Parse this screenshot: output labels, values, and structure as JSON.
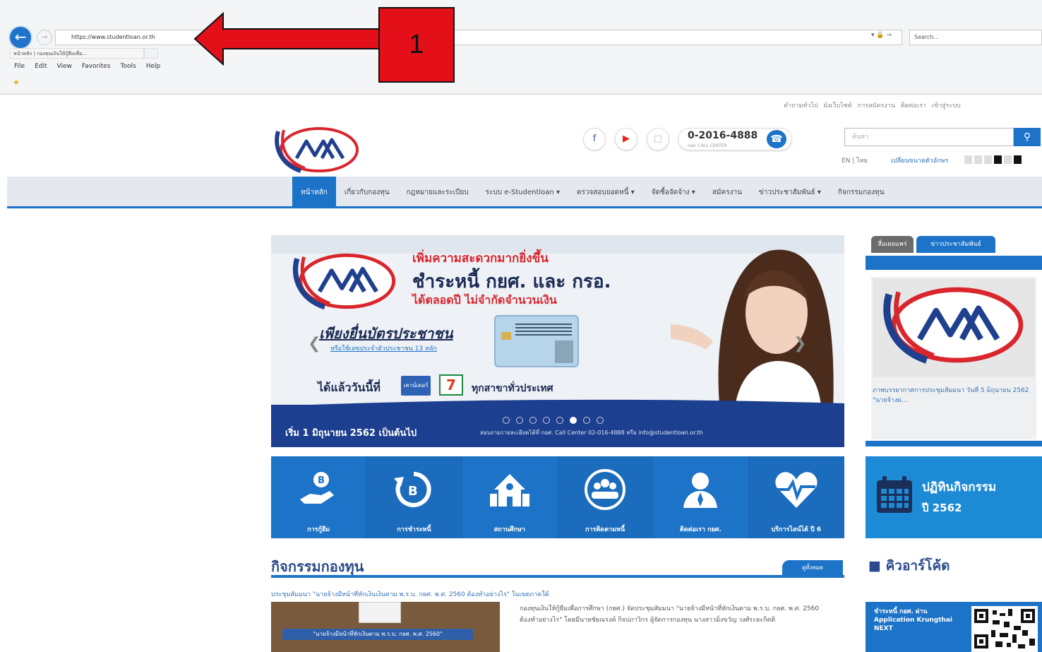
{
  "browser": {
    "url": "https://www.studentloan.or.th",
    "search_placeholder": "Search...",
    "tab_title": "หน้าหลัก | กองทุนเงินให้กู้ยืมเพื่อ...",
    "menu": [
      "File",
      "Edit",
      "View",
      "Favorites",
      "Tools",
      "Help"
    ]
  },
  "annotation": {
    "callout_number": "1",
    "arrow_color": "#e3101a"
  },
  "site": {
    "utility_links": [
      "คำถามทั่วไป",
      "ผังเว็บไซต์",
      "การสมัครงาน",
      "ติดต่อเรา",
      "เข้าสู่ระบบ"
    ],
    "phone": {
      "number": "0-2016-4888",
      "sub": "กยศ. CALL CENTER"
    },
    "search_placeholder": "ค้นหา",
    "language": "EN | ไทย",
    "font_size_label": "เปลี่ยนขนาดตัวอักษร",
    "nav": [
      "หน้าหลัก",
      "เกี่ยวกับกองทุน",
      "กฎหมายและระเบียบ",
      "ระบบ e-Studentloan ▾",
      "ตรวจสอบยอดหนี้ ▾",
      "จัดซื้อจัดจ้าง ▾",
      "สมัครงาน",
      "ข่าวประชาสัมพันธ์ ▾",
      "กิจกรรมกองทุน"
    ],
    "accent_color": "#1c73c7"
  },
  "banner": {
    "heading1": "เพิ่มความสะดวกมากยิ่งขึ้น",
    "heading2": "ชำระหนี้ กยศ. และ กรอ.",
    "heading3": "ได้ตลอดปี ไม่จำกัดจำนวนเงิน",
    "id_text": "เพียงยื่นบัตรประชาชน",
    "id_sub": "หรือใช้เลขประจำตัวประชาชน 13 หลัก",
    "today_text": "ได้แล้ววันนี้ที่",
    "store1": "เคาน์เตอร์",
    "store2": "7",
    "branches_text": "ทุกสาขาทั่วประเทศ",
    "start_text": "เริ่ม 1 มิถุนายน 2562 เป็นต้นไป",
    "contact_text": "สอบถามรายละเอียดได้ที่ กยศ. Call Center 02-016-4888 หรือ info@studentloan.or.th",
    "slide_count": 8,
    "active_slide": 6
  },
  "services": [
    {
      "label": "การกู้ยืม",
      "icon": "loan-hand-icon"
    },
    {
      "label": "การชำระหนี้",
      "icon": "repay-icon"
    },
    {
      "label": "สถานศึกษา",
      "icon": "school-icon"
    },
    {
      "label": "การติดตามหนี้",
      "icon": "people-circle-icon"
    },
    {
      "label": "ติดต่อเรา กยศ.",
      "icon": "user-contact-icon"
    },
    {
      "label": "บริการไลน์ไต้ ปี 6",
      "icon": "heart-pulse-icon"
    }
  ],
  "sidebar": {
    "tab1": "สื่อเผยแพร่",
    "tab2": "ข่าวประชาสัมพันธ์",
    "card_text": "ภาพบรรยากาศการประชุมสัมมนา วันที่ 5 มิถุนายน 2562 \"นายจ้างผ...",
    "calendar_title": "ปฏิทินกิจกรรม",
    "calendar_year": "ปี 2562"
  },
  "activities": {
    "title": "กิจกรรมกองทุน",
    "more_label": "ดูทั้งหมด",
    "headline": "ประชุมสัมมนา \"นายจ้างมีหน้าที่หักเงินเงินตาม พ.ร.บ. กยศ. พ.ศ. 2560 ต้องทำอย่างไร\" ในเขตภาคใต้",
    "summary": "กองทุนเงินให้กู้ยืมเพื่อการศึกษา (กยศ.) จัดประชุมสัมมนา \"นายจ้างมีหน้าที่หักเงินตาม พ.ร.บ. กยศ. พ.ศ. 2560 ต้องทำอย่างไร\" โดยมีนายชัยณรงค์ กิจปภาวิกร ผู้จัดการกองทุน นางสาวมิ่งขวัญ วงศ์ระยะกิตติ",
    "thumb_sign": "\"นายจ้างมีหน้าที่หักเงินตาม พ.ร.บ. กยศ. พ.ศ. 2560\""
  },
  "qr": {
    "title": "คิวอาร์โค้ด",
    "text": "ชำระหนี้ กยศ. ผ่าน Application Krungthai NEXT"
  }
}
